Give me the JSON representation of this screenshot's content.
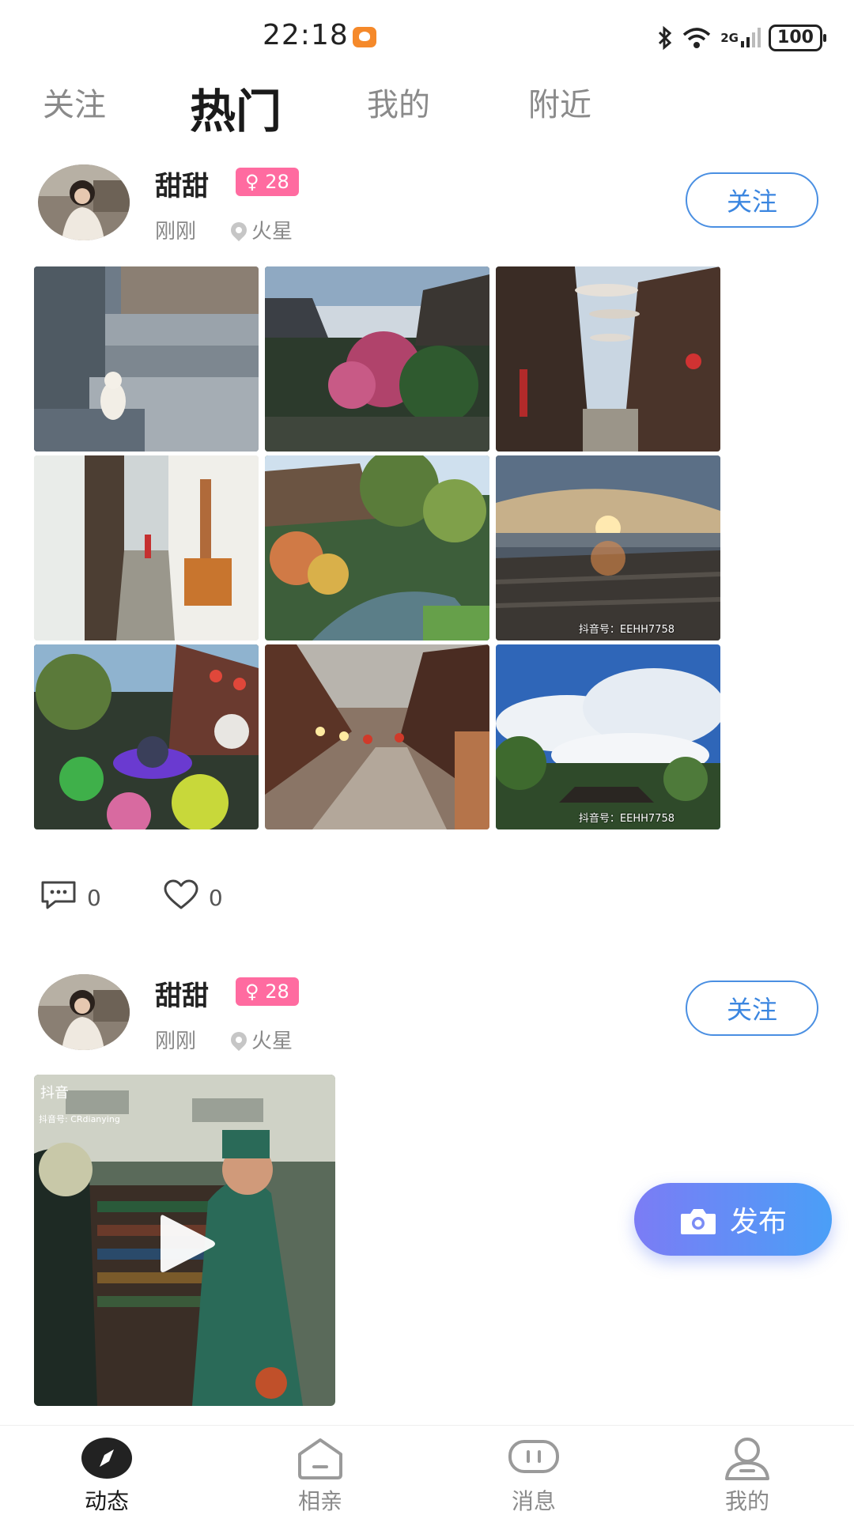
{
  "status_bar": {
    "time": "22:18",
    "battery": "100",
    "signal_label": "2G"
  },
  "tabs": [
    {
      "label": "关注",
      "active": false
    },
    {
      "label": "热门",
      "active": true
    },
    {
      "label": "我的",
      "active": false
    },
    {
      "label": "附近",
      "active": false
    }
  ],
  "posts": [
    {
      "username": "甜甜",
      "gender_age": "♀ 28",
      "time": "刚刚",
      "location": "火星",
      "follow_label": "关注",
      "photo_watermarks": [
        "抖音号：EEHH7758",
        "抖音号：EEHH7758"
      ],
      "comments": "0",
      "likes": "0"
    },
    {
      "username": "甜甜",
      "gender_age": "♀ 28",
      "time": "刚刚",
      "location": "火星",
      "follow_label": "关注",
      "video_brand": "抖音",
      "video_account": "抖音号: CRdianying"
    }
  ],
  "fab": {
    "label": "发布"
  },
  "bottom_nav": [
    {
      "label": "动态",
      "active": true
    },
    {
      "label": "相亲",
      "active": false
    },
    {
      "label": "消息",
      "active": false
    },
    {
      "label": "我的",
      "active": false
    }
  ],
  "colors": {
    "accent_blue": "#3b86e0",
    "gender_pink": "#ff6ba0",
    "fab_start": "#7b7cf5",
    "fab_end": "#4a9ff7"
  }
}
